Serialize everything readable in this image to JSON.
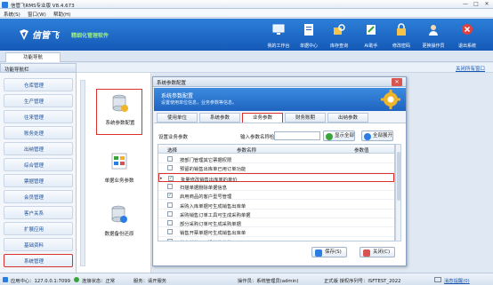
{
  "window": {
    "title": "信管飞RMS专业版 V8.4.673",
    "controls": [
      "—",
      "□",
      "✕"
    ]
  },
  "menu": [
    "系统(S)",
    "窗口(W)",
    "帮助(H)"
  ],
  "brand": {
    "name": "信管飞",
    "tagline": "精细化管理软件"
  },
  "header_buttons": [
    {
      "label": "我的工作台",
      "icon": "monitor-icon"
    },
    {
      "label": "单据中心",
      "icon": "document-center-icon"
    },
    {
      "label": "库存查询",
      "icon": "inventory-query-icon"
    },
    {
      "label": "AI助手",
      "icon": "ai-assistant-icon"
    },
    {
      "label": "修改密码",
      "icon": "lock-icon"
    },
    {
      "label": "更换操作员",
      "icon": "switch-user-icon"
    },
    {
      "label": "退出系统",
      "icon": "exit-icon"
    }
  ],
  "tabs": {
    "home": "功能导航"
  },
  "nav": {
    "title": "功能导航栏",
    "close_all": "关闭所有窗口",
    "items": [
      "仓库管理",
      "生产管理",
      "往来管理",
      "账务处理",
      "出纳管理",
      "综合管理",
      "票据管理",
      "会员管理",
      "客户关系",
      "扩展应用",
      "基础资料",
      "系统管理"
    ],
    "active": "系统管理"
  },
  "subpanel": [
    "系统参数配置",
    "单据业务参数",
    "数据备份还原"
  ],
  "dialog": {
    "title": "系统参数配置",
    "heading": "系统参数配置",
    "subheading": "设置使用单位信息，业务参数等信息。",
    "tabs": [
      "使用单位",
      "系统参数",
      "业务参数",
      "财务账期",
      "出纳参数"
    ],
    "selected_tab": "业务参数",
    "config_label": "设置业务参数",
    "search_label": "输入参数名称检索：",
    "search_value": "",
    "show_all": "显示全部",
    "expand_all": "全部展开",
    "columns": [
      "选择",
      "参数名称",
      "参数值"
    ],
    "rows": [
      {
        "name": "按部门管理其它票据权限",
        "checked": false,
        "indicator": ""
      },
      {
        "name": "预留的销售出库单已用订单功能",
        "checked": false,
        "indicator": ""
      },
      {
        "name": "批量修改销售出库单的单价",
        "checked": true,
        "indicator": "▸"
      },
      {
        "name": "扫描单据删除单据信息",
        "checked": false,
        "indicator": ""
      },
      {
        "name": "启用商品的客户型号管理",
        "checked": true,
        "indicator": ""
      },
      {
        "name": "采购入库单据可生成销售出库单",
        "checked": false,
        "indicator": ""
      },
      {
        "name": "采购销售订单工具可生成采购单据",
        "checked": false,
        "indicator": ""
      },
      {
        "name": "部分采购订单可生成采购单据",
        "checked": false,
        "indicator": ""
      },
      {
        "name": "销售开票单据可生成销售出库单",
        "checked": false,
        "indicator": ""
      },
      {
        "name": "往来单位可开设单位价格",
        "checked": false,
        "indicator": ""
      }
    ],
    "highlighted_row": 2,
    "save": "保存(S)",
    "close": "关闭(C)"
  },
  "status": {
    "app_center": "应用中心：127.0.0.1:7099",
    "connection": "连接状态：正常",
    "sync": "服务：请开服务",
    "operator": "操作员：系统管理员(admin)",
    "license": "正式版 授权序列号：ISFTEST_2022",
    "messages": "消息提醒(0)"
  },
  "colors": {
    "accent_red": "#d9322e",
    "brand_blue": "#1f64c0",
    "nav_text": "#1b4f9a"
  }
}
